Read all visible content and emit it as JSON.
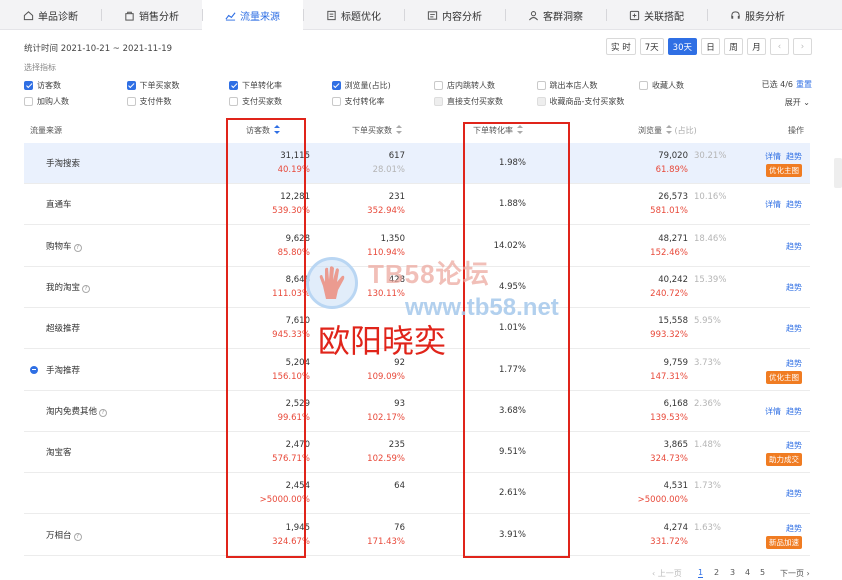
{
  "nav": {
    "tabs": [
      {
        "label": "单品诊断",
        "icon": "home-icon"
      },
      {
        "label": "销售分析",
        "icon": "bag-icon"
      },
      {
        "label": "流量来源",
        "icon": "trend-icon",
        "active": true
      },
      {
        "label": "标题优化",
        "icon": "document-icon"
      },
      {
        "label": "内容分析",
        "icon": "content-icon"
      },
      {
        "label": "客群洞察",
        "icon": "user-icon"
      },
      {
        "label": "关联搭配",
        "icon": "link-icon"
      },
      {
        "label": "服务分析",
        "icon": "headset-icon"
      }
    ]
  },
  "date_range": "统计时间 2021-10-21 ~ 2021-11-19",
  "range_buttons": [
    "实 时",
    "7天",
    "30天",
    "日",
    "周",
    "月",
    "‹",
    "›"
  ],
  "select_label": "选择指标",
  "metrics_row1": [
    {
      "label": "访客数",
      "checked": true
    },
    {
      "label": "下单买家数",
      "checked": true
    },
    {
      "label": "下单转化率",
      "checked": true
    },
    {
      "label": "浏览量(占比)",
      "checked": true
    },
    {
      "label": "店内跳转人数",
      "checked": false
    },
    {
      "label": "跳出本店人数",
      "checked": false
    },
    {
      "label": "收藏人数",
      "checked": false
    }
  ],
  "metrics_row2": [
    {
      "label": "加购人数",
      "checked": false
    },
    {
      "label": "支付件数",
      "checked": false
    },
    {
      "label": "支付买家数",
      "checked": false
    },
    {
      "label": "支付转化率",
      "checked": false
    },
    {
      "label": "直接支付买家数",
      "checked": false,
      "disabled": true
    },
    {
      "label": "收藏商品-支付买家数",
      "checked": false,
      "disabled": true
    }
  ],
  "selected_count": "已选 4/6",
  "reset_label": "重置",
  "expand_label": "展开",
  "headers": {
    "source": "流量来源",
    "visitors": "访客数",
    "buyers": "下单买家数",
    "conversion": "下单转化率",
    "pageviews": "浏览量",
    "share": "(占比)",
    "ops": "操作"
  },
  "rows": [
    {
      "source": "手淘搜索",
      "q": false,
      "minus": false,
      "visitors": "31,115",
      "visitors_pct": "40.19%",
      "buyers": "617",
      "buyers_pct": "28.01%",
      "buyers_pct_gray": true,
      "conversion": "1.98%",
      "pageviews": "79,020",
      "share": "30.21%",
      "pv_pct": "61.89%",
      "ops": [
        "详情",
        "趋势"
      ],
      "tag": "优化主图"
    },
    {
      "source": "直通车",
      "q": false,
      "minus": false,
      "visitors": "12,281",
      "visitors_pct": "539.30%",
      "buyers": "231",
      "buyers_pct": "352.94%",
      "buyers_pct_gray": false,
      "conversion": "1.88%",
      "pageviews": "26,573",
      "share": "10.16%",
      "pv_pct": "581.01%",
      "ops": [
        "详情",
        "趋势"
      ],
      "tag": ""
    },
    {
      "source": "购物车",
      "q": true,
      "minus": false,
      "visitors": "9,628",
      "visitors_pct": "85.80%",
      "buyers": "1,350",
      "buyers_pct": "110.94%",
      "buyers_pct_gray": false,
      "conversion": "14.02%",
      "pageviews": "48,271",
      "share": "18.46%",
      "pv_pct": "152.46%",
      "ops": [
        "趋势"
      ],
      "tag": ""
    },
    {
      "source": "我的淘宝",
      "q": true,
      "minus": false,
      "visitors": "8,648",
      "visitors_pct": "111.03%",
      "buyers": "428",
      "buyers_pct": "130.11%",
      "buyers_pct_gray": false,
      "conversion": "4.95%",
      "pageviews": "40,242",
      "share": "15.39%",
      "pv_pct": "240.72%",
      "ops": [
        "趋势"
      ],
      "tag": ""
    },
    {
      "source": "超级推荐",
      "q": false,
      "minus": false,
      "visitors": "7,610",
      "visitors_pct": "945.33%",
      "buyers": "",
      "buyers_pct": "",
      "buyers_pct_gray": false,
      "conversion": "1.01%",
      "pageviews": "15,558",
      "share": "5.95%",
      "pv_pct": "993.32%",
      "ops": [
        "趋势"
      ],
      "tag": ""
    },
    {
      "source": "手淘推荐",
      "q": false,
      "minus": true,
      "visitors": "5,204",
      "visitors_pct": "156.10%",
      "buyers": "92",
      "buyers_pct": "109.09%",
      "buyers_pct_gray": false,
      "conversion": "1.77%",
      "pageviews": "9,759",
      "share": "3.73%",
      "pv_pct": "147.31%",
      "ops": [
        "趋势"
      ],
      "tag": "优化主图"
    },
    {
      "source": "淘内免费其他",
      "q": true,
      "minus": false,
      "visitors": "2,529",
      "visitors_pct": "99.61%",
      "buyers": "93",
      "buyers_pct": "102.17%",
      "buyers_pct_gray": false,
      "conversion": "3.68%",
      "pageviews": "6,168",
      "share": "2.36%",
      "pv_pct": "139.53%",
      "ops": [
        "详情",
        "趋势"
      ],
      "tag": ""
    },
    {
      "source": "淘宝客",
      "q": false,
      "minus": false,
      "visitors": "2,470",
      "visitors_pct": "576.71%",
      "buyers": "235",
      "buyers_pct": "102.59%",
      "buyers_pct_gray": false,
      "conversion": "9.51%",
      "pageviews": "3,865",
      "share": "1.48%",
      "pv_pct": "324.73%",
      "ops": [
        "趋势"
      ],
      "tag": "助力成交"
    },
    {
      "source": "",
      "q": false,
      "minus": false,
      "visitors": "2,454",
      "visitors_pct": ">5000.00%",
      "buyers": "64",
      "buyers_pct": "",
      "buyers_pct_gray": false,
      "conversion": "2.61%",
      "pageviews": "4,531",
      "share": "1.73%",
      "pv_pct": ">5000.00%",
      "ops": [
        "趋势"
      ],
      "tag": ""
    },
    {
      "source": "万相台",
      "q": true,
      "minus": false,
      "visitors": "1,945",
      "visitors_pct": "324.67%",
      "buyers": "76",
      "buyers_pct": "171.43%",
      "buyers_pct_gray": false,
      "conversion": "3.91%",
      "pageviews": "4,274",
      "share": "1.63%",
      "pv_pct": "331.72%",
      "ops": [
        "趋势"
      ],
      "tag": "新品加速"
    }
  ],
  "watermark": {
    "brand": "TB58论坛",
    "url": "www.tb58.net"
  },
  "annotation": "欧阳晓奕",
  "pager": {
    "prev": "‹ 上一页",
    "pages": [
      "1",
      "2",
      "3",
      "4",
      "5"
    ],
    "next": "下一页 ›"
  }
}
